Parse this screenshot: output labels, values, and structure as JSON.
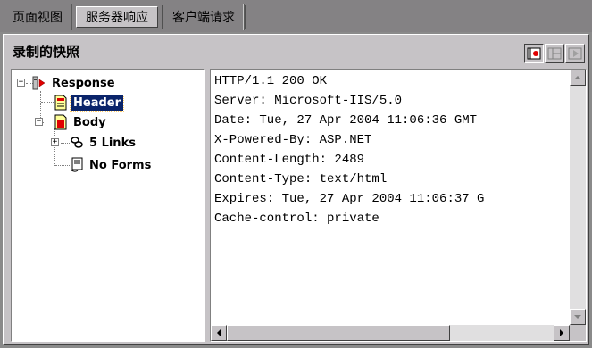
{
  "tabs": [
    {
      "label": "页面视图",
      "active": false
    },
    {
      "label": "服务器响应",
      "active": true
    },
    {
      "label": "客户端请求",
      "active": false
    }
  ],
  "panel": {
    "title": "录制的快照",
    "buttons": [
      {
        "icon": "record-snapshot-icon",
        "pressed": true
      },
      {
        "icon": "split-view-icon",
        "pressed": false
      },
      {
        "icon": "play-icon",
        "pressed": false
      }
    ]
  },
  "tree": {
    "nodes": [
      {
        "label": "Response",
        "icon": "response-icon",
        "expander": "−"
      },
      {
        "label": "Header",
        "icon": "header-page-icon",
        "selected": true
      },
      {
        "label": "Body",
        "icon": "body-page-icon",
        "expander": "−"
      },
      {
        "label": "5 Links",
        "icon": "links-icon",
        "expander": "+"
      },
      {
        "label": "No Forms",
        "icon": "forms-icon"
      }
    ]
  },
  "headers": [
    "HTTP/1.1 200 OK",
    "Server: Microsoft-IIS/5.0",
    "Date: Tue, 27 Apr 2004 11:06:36 GMT",
    "X-Powered-By: ASP.NET",
    "Content-Length: 2489",
    "Content-Type: text/html",
    "Expires: Tue, 27 Apr 2004 11:06:37 G",
    "Cache-control: private"
  ],
  "colors": {
    "selection": "#0a246a",
    "panel": "#c6c3c6",
    "record_red": "#e00000"
  }
}
